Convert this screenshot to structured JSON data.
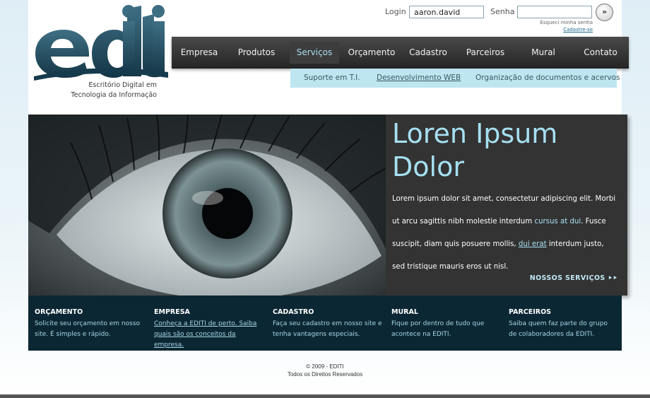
{
  "logo": {
    "text": "editi",
    "tagline_lines": [
      "Escritório Digital em",
      "Tecnologia da Informação"
    ]
  },
  "login": {
    "login_label": "Login",
    "login_value": "aaron.david",
    "password_label": "Senha",
    "password_value": "",
    "submit_icon": "double-chevron-right-icon",
    "submit_glyph": "»",
    "forgot_link": "Esqueci minha senha",
    "register_link": "Cadastre-se"
  },
  "nav": {
    "items": [
      {
        "label": "Empresa"
      },
      {
        "label": "Produtos"
      },
      {
        "label": "Serviços"
      },
      {
        "label": "Orçamento"
      },
      {
        "label": "Cadastro"
      },
      {
        "label": "Parceiros"
      },
      {
        "label": "Mural"
      },
      {
        "label": "Contato"
      }
    ],
    "active": "Serviços"
  },
  "subnav": {
    "items": [
      {
        "label": "Suporte em T.I."
      },
      {
        "label": "Desenvolvimento WEB"
      },
      {
        "label": "Organização de documentos e acervos"
      }
    ],
    "active": "Desenvolvimento WEB"
  },
  "hero": {
    "title": "Loren Ipsum Dolor",
    "body_1": "Lorem ipsum dolor sit amet, consectetur adipiscing elit. Morbi ut arcu sagittis nibh molestie interdum ",
    "body_link_1": "cursus at dui",
    "body_2": ". Fusce suscipit, diam quis posuere mollis, ",
    "body_link_2": "dui erat",
    "body_3": " interdum justo, sed tristique mauris eros ut nisl.",
    "cta": "NOSSOS SERVIÇOS",
    "cta_icon": "double-arrow-right-icon",
    "cta_glyph": "⯈⯈"
  },
  "footer_columns": [
    {
      "title": "ORÇAMENTO",
      "text": "Solicite seu orçamento em nosso site. É simples e rápido."
    },
    {
      "title": "EMPRESA",
      "text": "Conheça a EDITI de perto. Saiba quais são os conceitos da empresa."
    },
    {
      "title": "CADASTRO",
      "text": "Faça seu cadastro em nosso site e tenha vantagens especiais."
    },
    {
      "title": "MURAL",
      "text": "Fique por dentro de tudo que acontece na EDITI."
    },
    {
      "title": "PARCEIROS",
      "text": "Saiba quem faz parte do grupo de colaboradores da EDITI."
    }
  ],
  "copyright": {
    "line1": "© 2009 - EDITI",
    "line2": "Todos os Direitos Reservados"
  },
  "colors": {
    "nav_bg": "#2a2a2a",
    "accent_blue": "#a6e0f2",
    "subnav_bg": "#bde6f1",
    "band_bg": "#0c2734",
    "logo_blue": "#1f4f64"
  }
}
